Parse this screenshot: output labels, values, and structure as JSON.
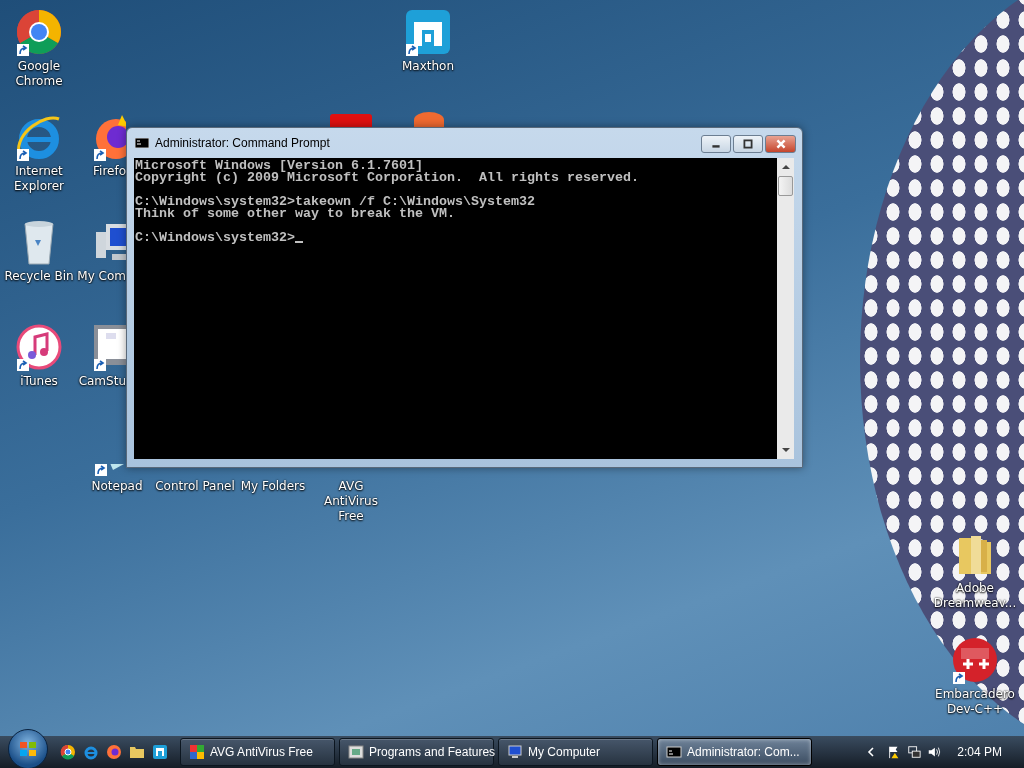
{
  "desktop_icons": [
    {
      "label": "Google Chrome",
      "kind": "chrome",
      "shortcut": true
    },
    {
      "label": "Maxthon",
      "kind": "maxthon",
      "shortcut": true
    },
    {
      "label": "Internet Explorer",
      "kind": "ie",
      "shortcut": true
    },
    {
      "label": "Firefo",
      "kind": "firefox",
      "shortcut": true
    },
    {
      "label": "Recycle Bin",
      "kind": "recycle",
      "shortcut": false
    },
    {
      "label": "My Com",
      "kind": "computer",
      "shortcut": false
    },
    {
      "label": "iTunes",
      "kind": "itunes",
      "shortcut": true
    },
    {
      "label": "CamStu",
      "kind": "camstudio",
      "shortcut": true
    },
    {
      "label": "Notepad",
      "kind": "notepad",
      "shortcut": true
    },
    {
      "label": "Control Panel"
    },
    {
      "label": "My Folders"
    },
    {
      "label": "AVG AntiVirus Free"
    },
    {
      "label": "Adobe Dreamweav...",
      "kind": "folder",
      "shortcut": false
    },
    {
      "label": "Embarcadero Dev-C++",
      "kind": "devcpp",
      "shortcut": true
    }
  ],
  "window": {
    "title": "Administrator:  Command Prompt",
    "console_blocks": [
      [
        "Microsoft Windows [Version 6.1.7601]",
        "Copyright (c) 2009 Microsoft Corporation.  All rights reserved."
      ],
      [
        "C:\\Windows\\system32>takeown /f C:\\Windows\\System32",
        "Think of some other way to break the VM."
      ],
      [
        "C:\\Windows\\system32>"
      ]
    ]
  },
  "taskbar": {
    "quick_launch": [
      {
        "kind": "chrome"
      },
      {
        "kind": "ie"
      },
      {
        "kind": "firefox"
      },
      {
        "kind": "folder"
      },
      {
        "kind": "maxthon"
      }
    ],
    "tasks": [
      {
        "label": "AVG AntiVirus Free",
        "kind": "avg",
        "selected": false
      },
      {
        "label": "Programs and Features",
        "kind": "programs",
        "selected": false
      },
      {
        "label": "My Computer",
        "kind": "computer",
        "selected": false
      },
      {
        "label": "Administrator:  Com...",
        "kind": "cmd",
        "selected": true
      }
    ],
    "clock": "2:04 PM"
  }
}
